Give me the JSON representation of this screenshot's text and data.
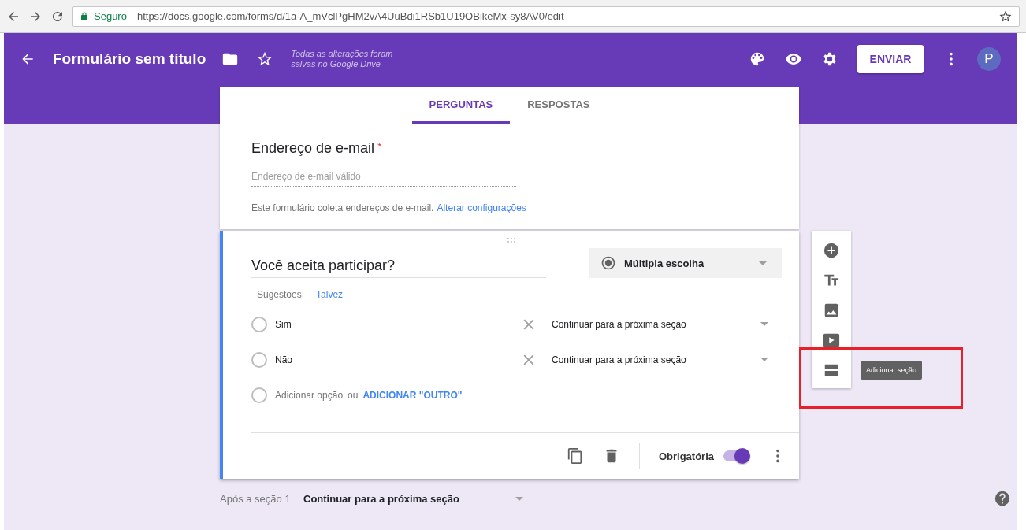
{
  "browser": {
    "secure_label": "Seguro",
    "url": "https://docs.google.com/forms/d/1a-A_mVclPgHM2vA4UuBdi1RSb1U19OBikeMx-sy8AV0/edit"
  },
  "header": {
    "title": "Formulário sem título",
    "save_status": "Todas as alterações foram\nsalvas no Google Drive",
    "send_button": "ENVIAR",
    "avatar": "P"
  },
  "tabs": [
    {
      "label": "PERGUNTAS",
      "selected": true
    },
    {
      "label": "RESPOSTAS",
      "selected": false
    }
  ],
  "email_section": {
    "title": "Endereço de e-mail",
    "required_mark": "*",
    "placeholder": "Endereço de e-mail válido",
    "note": "Este formulário coleta endereços de e-mail.",
    "link": "Alterar configurações"
  },
  "question": {
    "title": "Você aceita participar?",
    "type": "Múltipla escolha",
    "suggestions_label": "Sugestões:",
    "suggestions": [
      "Talvez"
    ],
    "options": [
      {
        "label": "Sim",
        "checked": false,
        "go_to": "Continuar para a próxima seção"
      },
      {
        "label": "Não",
        "checked": false,
        "go_to": "Continuar para a próxima seção"
      }
    ],
    "add_option": "Adicionar opção",
    "add_option_checked": false,
    "or": "ou",
    "add_other": "ADICIONAR \"OUTRO\"",
    "required_label": "Obrigatória",
    "required": true
  },
  "after_section": {
    "label": "Após a seção 1",
    "value": "Continuar para a próxima seção"
  },
  "toolbar": {
    "tooltip": "Adicionar seção"
  }
}
